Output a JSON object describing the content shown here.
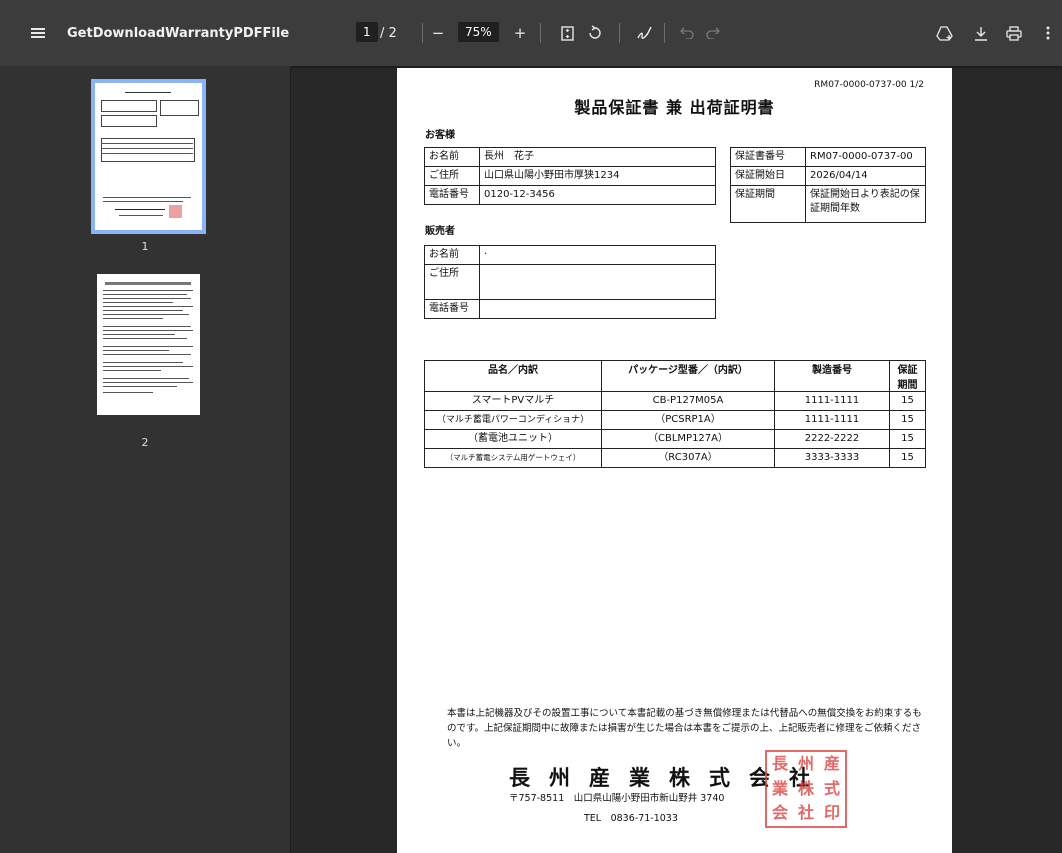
{
  "toolbar": {
    "title": "GetDownloadWarrantyPDFFile",
    "page_current": "1",
    "page_total": "/ 2",
    "zoom": "75%",
    "minus": "−",
    "plus": "+",
    "fit_icon": "fit-page-icon",
    "rotate_icon": "rotate-icon",
    "annotate_icon": "pen-icon",
    "undo_icon": "undo-icon",
    "redo_icon": "redo-icon",
    "drive_icon": "save-to-drive-icon",
    "download_icon": "download-icon",
    "print_icon": "print-icon",
    "more_icon": "more-vert-icon"
  },
  "sidebar": {
    "thumbnails": [
      {
        "label": "1"
      },
      {
        "label": "2"
      }
    ]
  },
  "doc": {
    "ref": "RM07-0000-0737-00 1/2",
    "title": "製品保証書 兼 出荷証明書",
    "customer_heading": "お客様",
    "customer": [
      {
        "label": "お名前",
        "value": "長州　花子"
      },
      {
        "label": "ご住所",
        "value": "山口県山陽小野田市厚狭1234"
      },
      {
        "label": "電話番号",
        "value": "0120-12-3456"
      }
    ],
    "warranty": [
      {
        "label": "保証書番号",
        "value": "RM07-0000-0737-00"
      },
      {
        "label": "保証開始日",
        "value": "2026/04/14"
      },
      {
        "label": "保証期間",
        "value": "保証開始日より表記の保証期間年数"
      }
    ],
    "seller_heading": "販売者",
    "seller": [
      {
        "label": "お名前",
        "value": "·"
      },
      {
        "label": "ご住所",
        "value": ""
      },
      {
        "label": "電話番号",
        "value": ""
      }
    ],
    "items_headers": [
      "品名／内訳",
      "パッケージ型番／（内訳）",
      "製造番号",
      "保証期間"
    ],
    "items": [
      [
        "スマートPVマルチ",
        "CB-P127M05A",
        "1111-1111",
        "15"
      ],
      [
        "（マルチ蓄電パワーコンディショナ）",
        "（PCSRP1A）",
        "1111-1111",
        "15"
      ],
      [
        "（蓄電池ユニット）",
        "（CBLMP127A）",
        "2222-2222",
        "15"
      ],
      [
        "（マルチ蓄電システム用ゲートウェイ）",
        "（RC307A）",
        "3333-3333",
        "15"
      ]
    ],
    "footer_text": "本書は上記機器及びその設置工事について本書記載の基づき無償修理または代替品への無償交換をお約束するものです。上記保証期間中に故障または損害が生じた場合は本書をご提示の上、上記販売者に修理をご依頼ください。",
    "company": "長州産業株式会社",
    "address": "〒757-8511　山口県山陽小野田市新山野井 3740",
    "tel": "TEL　0836-71-1033",
    "seal_chars": [
      "長",
      "州",
      "産",
      "業",
      "株",
      "式",
      "会",
      "社",
      "印"
    ]
  }
}
